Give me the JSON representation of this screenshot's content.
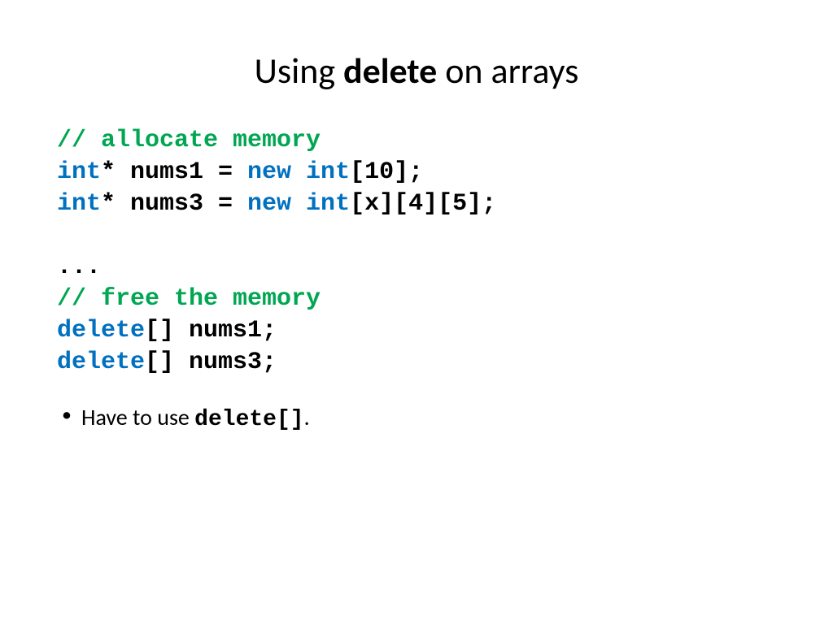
{
  "title": {
    "pre": "Using ",
    "bold": "delete",
    "post": " on arrays"
  },
  "code": {
    "line1": "// allocate memory",
    "line2_kw1": "int",
    "line2_mid": "* nums1 = ",
    "line2_kw2": "new int",
    "line2_end": "[10];",
    "line3_kw1": "int",
    "line3_mid": "* nums3 = ",
    "line3_kw2": "new int",
    "line3_end": "[x][4][5];",
    "line4": "...",
    "line5": "// free the memory",
    "line6_kw": "delete",
    "line6_end": "[] nums1;",
    "line7_kw": "delete",
    "line7_end": "[] nums3;"
  },
  "bullet": {
    "pre": "Have to use ",
    "mono": "delete[]",
    "post": "."
  }
}
